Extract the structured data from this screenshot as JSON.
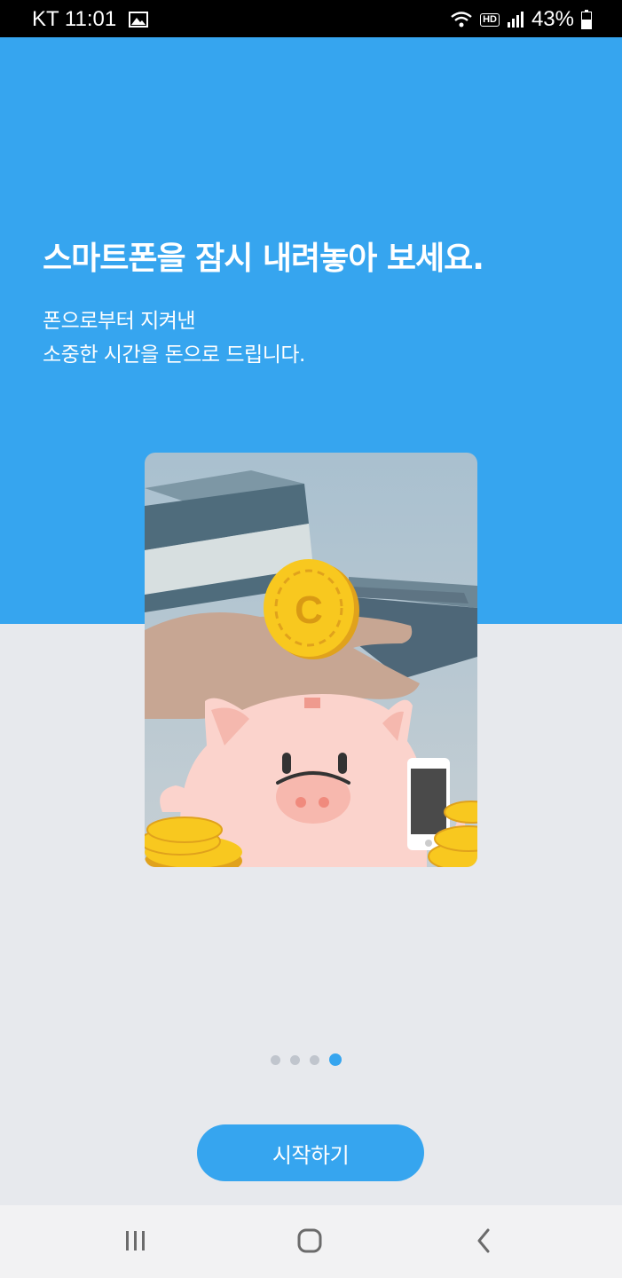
{
  "status_bar": {
    "carrier_time": "KT 11:01",
    "hd_label": "HD",
    "battery": "43%",
    "icons": [
      "gallery-icon",
      "wifi-icon",
      "signal-icon",
      "battery-icon"
    ]
  },
  "hero": {
    "headline": "스마트폰을 잠시 내려놓아 보세요.",
    "sub_line1": "폰으로부터 지켜낸",
    "sub_line2": "소중한 시간을 돈으로 드립니다.",
    "coin_letter": "C"
  },
  "pager": {
    "count": 4,
    "active_index": 3
  },
  "start_button_label": "시작하기",
  "nav_bar": {
    "icons": [
      "recent-apps-icon",
      "home-icon",
      "back-icon"
    ]
  },
  "colors": {
    "primary": "#36a5ef",
    "background": "#e7e9ed",
    "pig": "#fbd3cc",
    "coin": "#f8c81f"
  }
}
